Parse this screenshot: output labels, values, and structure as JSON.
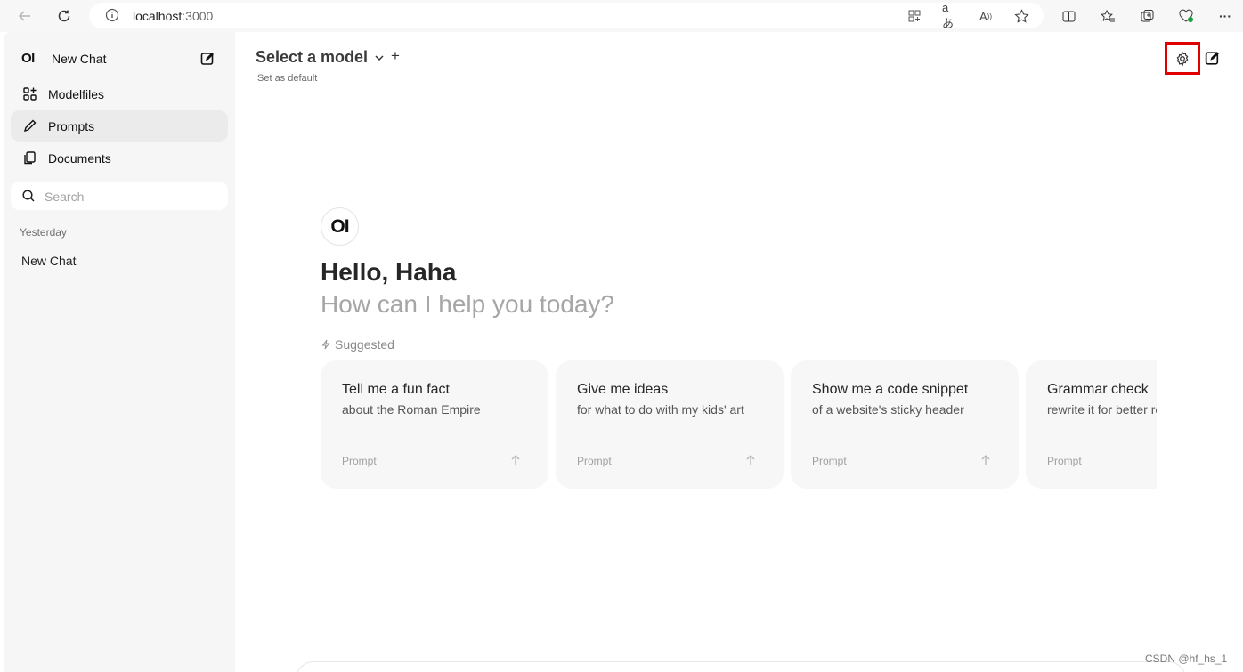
{
  "browser": {
    "url_host": "localhost",
    "url_port": ":3000"
  },
  "sidebar": {
    "logo_text": "OI",
    "new_chat_label": "New Chat",
    "items": [
      {
        "label": "Modelfiles",
        "icon": "modelfiles-icon",
        "active": false
      },
      {
        "label": "Prompts",
        "icon": "pencil-icon",
        "active": true
      },
      {
        "label": "Documents",
        "icon": "documents-icon",
        "active": false
      }
    ],
    "search_placeholder": "Search",
    "group_label": "Yesterday",
    "chats": [
      "New Chat"
    ]
  },
  "header": {
    "model_selector_label": "Select a model",
    "set_default_label": "Set as default"
  },
  "welcome": {
    "logo_text": "OI",
    "greeting": "Hello, Haha",
    "subtitle": "How can I help you today?",
    "suggested_label": "Suggested"
  },
  "suggestions": [
    {
      "title": "Tell me a fun fact",
      "subtitle": "about the Roman Empire",
      "tag": "Prompt"
    },
    {
      "title": "Give me ideas",
      "subtitle": "for what to do with my kids' art",
      "tag": "Prompt"
    },
    {
      "title": "Show me a code snippet",
      "subtitle": "of a website's sticky header",
      "tag": "Prompt"
    },
    {
      "title": "Grammar check",
      "subtitle": "rewrite it for better readability",
      "tag": "Prompt"
    }
  ],
  "watermark": "CSDN @hf_hs_1",
  "colors": {
    "highlight_border": "#e00000",
    "sidebar_bg": "#f6f6f6",
    "card_bg": "#f7f7f7"
  }
}
